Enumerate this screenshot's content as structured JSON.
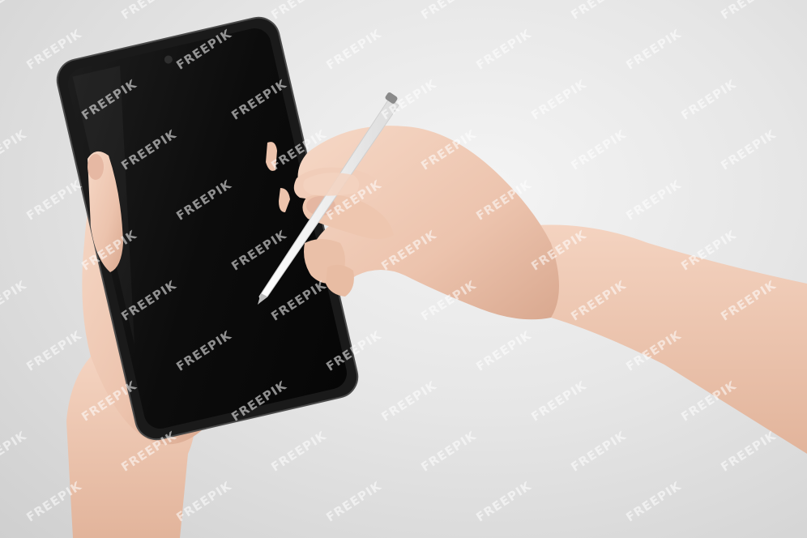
{
  "scene": {
    "description_kind": "product-photo",
    "background_color": "#e3e3e3",
    "phone_screen_color": "#0b0b0b",
    "phone_frame_color": "#1a1a1a",
    "stylus_color": "#f7f7f7",
    "skin_color": "#efc9b4"
  },
  "watermark": {
    "text": "FREEPIK"
  }
}
